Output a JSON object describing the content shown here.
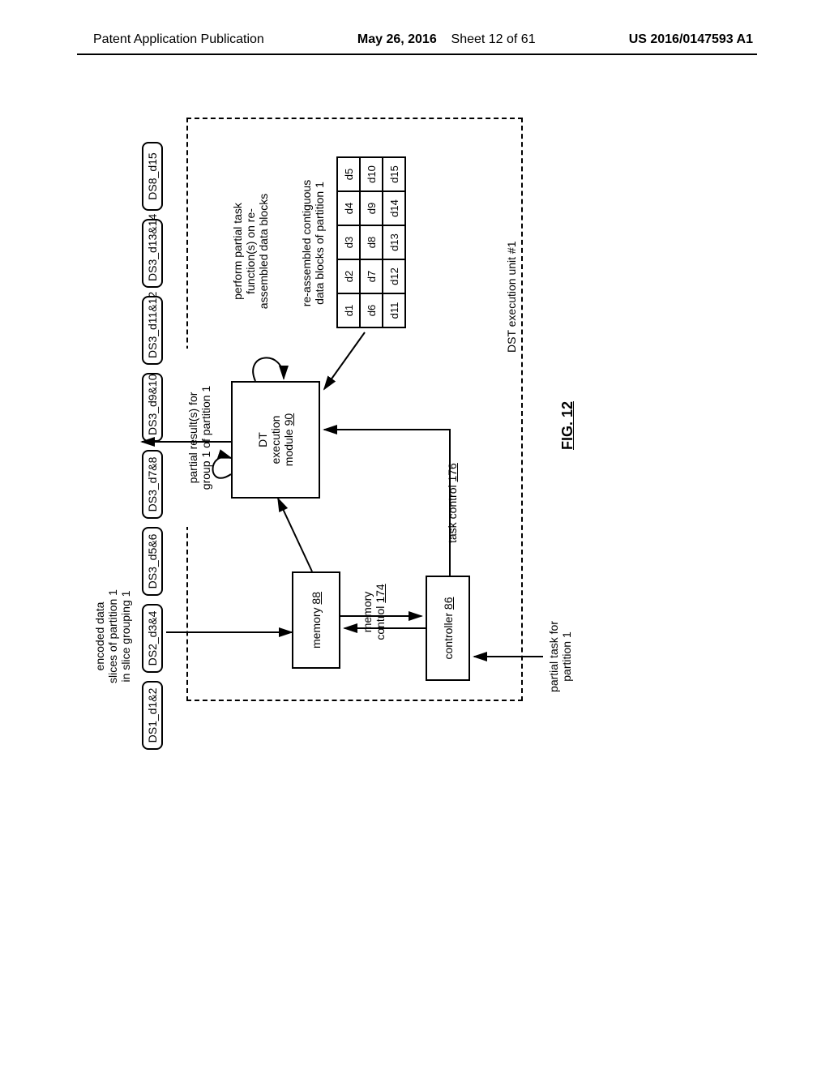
{
  "header": {
    "left": "Patent Application Publication",
    "center_date": "May 26, 2016",
    "center_sheet": "Sheet 12 of 61",
    "right": "US 2016/0147593 A1"
  },
  "slices_header": "encoded data\nslices of partition 1\nin slice grouping 1",
  "slices": [
    "DS1_d1&2",
    "DS2_d3&4",
    "DS3_d5&6",
    "DS3_d7&8",
    "DS3_d9&10",
    "DS3_d11&12",
    "DS3_d13&14",
    "DS8_d15"
  ],
  "partial_task": "partial task for\npartition 1",
  "controller": {
    "label": "controller ",
    "num": "86"
  },
  "memory_control": {
    "label": "memory\ncontrol ",
    "num": "174"
  },
  "task_control": {
    "label": "task control ",
    "num": "176"
  },
  "memory": {
    "label": "memory ",
    "num": "88"
  },
  "dt": {
    "label": "DT\nexecution\nmodule ",
    "num": "90"
  },
  "partial_results": "partial result(s) for\ngroup 1 of partition 1",
  "perform": "perform partial task\nfunction(s) on re-\nassembled data blocks",
  "reassembled": "re-assembled contiguous\ndata blocks of partition 1",
  "grid": {
    "rows": [
      [
        "d1",
        "d2",
        "d3",
        "d4",
        "d5"
      ],
      [
        "d6",
        "d7",
        "d8",
        "d9",
        "d10"
      ],
      [
        "d11",
        "d12",
        "d13",
        "d14",
        "d15"
      ]
    ]
  },
  "dst_label": "DST execution unit #1",
  "fig_label": "FIG. 12"
}
